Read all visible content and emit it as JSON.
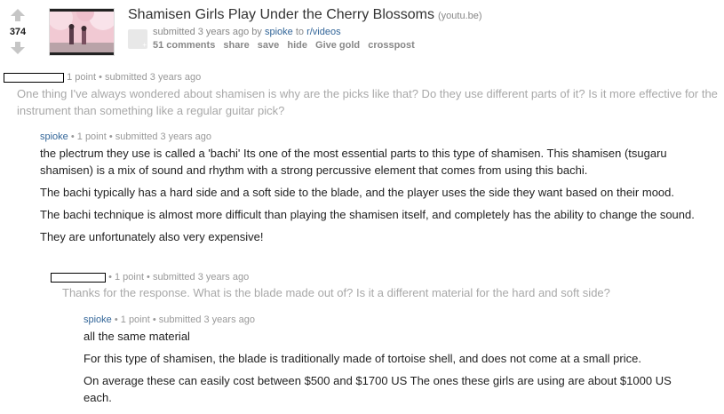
{
  "post": {
    "score": "374",
    "title": "Shamisen Girls Play Under the Cherry Blossoms",
    "domain": "(youtu.be)",
    "submitted_prefix": "submitted 3 years ago by",
    "author": "spioke",
    "to_word": "to",
    "subreddit": "r/videos",
    "actions": [
      "51 comments",
      "share",
      "save",
      "hide",
      "Give gold",
      "crosspost"
    ]
  },
  "comments": [
    {
      "author": "",
      "meta": "1 point • submitted 3 years ago",
      "paragraphs": [
        "One thing I've always wondered about shamisen is why are the picks like that? Do they use different parts of it? Is it more effective for the instrument than something like a regular guitar pick?"
      ]
    },
    {
      "author": "spioke",
      "meta": "• 1 point • submitted 3 years ago",
      "paragraphs": [
        "the plectrum they use is called a 'bachi' Its one of the most essential parts to this type of shamisen. This shamisen (tsugaru shamisen) is a mix of sound and rhythm with a strong percussive element that comes from using this bachi.",
        "The bachi typically has a hard side and a soft side to the blade, and the player uses the side they want based on their mood.",
        "The bachi technique is almost more difficult than playing the shamisen itself, and completely has the ability to change the sound.",
        "They are unfortunately also very expensive!"
      ]
    },
    {
      "author": "",
      "meta": "• 1 point • submitted 3 years ago",
      "paragraphs": [
        "Thanks for the response. What is the blade made out of? Is it a different material for the hard and soft side?"
      ]
    },
    {
      "author": "spioke",
      "meta": "• 1 point • submitted 3 years ago",
      "paragraphs": [
        "all the same material",
        "For this type of shamisen, the blade is traditionally made of tortoise shell, and does not come at a small price.",
        "On average these can easily cost between $500 and $1700 US The ones these girls are using are about $1000 US each."
      ]
    }
  ]
}
